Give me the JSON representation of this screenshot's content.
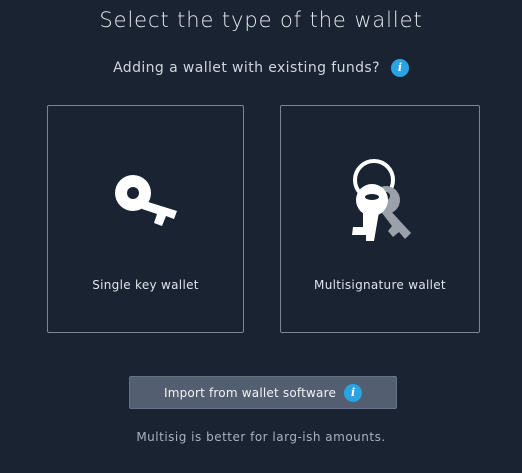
{
  "header": {
    "title": "Select the type of the wallet",
    "subtitle": "Adding a wallet with existing funds?",
    "info_glyph": "i"
  },
  "options": {
    "single": {
      "label": "Single key wallet",
      "icon": "key-icon"
    },
    "multi": {
      "label": "Multisignature wallet",
      "icon": "keyring-icon"
    }
  },
  "import": {
    "label": "Import from wallet software",
    "info_glyph": "i"
  },
  "note": "Multisig is better for larg-ish amounts.",
  "colors": {
    "background": "#1a2332",
    "card_border": "#7c8594",
    "info_badge": "#29a3e3",
    "button_bg": "#535e70",
    "key_primary": "#ffffff",
    "key_secondary": "#9aa1ab"
  }
}
